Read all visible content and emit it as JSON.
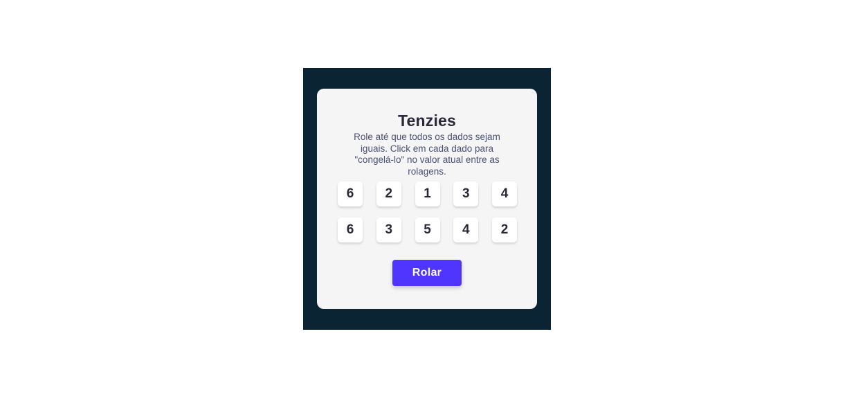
{
  "game": {
    "title": "Tenzies",
    "instructions": "Role até que todos os dados sejam iguais. Click em cada dado para \"congelá-lo\" no valor atual entre as rolagens.",
    "dice": [
      "6",
      "2",
      "1",
      "3",
      "4",
      "6",
      "3",
      "5",
      "4",
      "2"
    ],
    "roll_button_label": "Rolar"
  },
  "colors": {
    "background": "#0b2434",
    "card": "#f5f5f5",
    "accent": "#5035ff",
    "text": "#2b283a"
  }
}
